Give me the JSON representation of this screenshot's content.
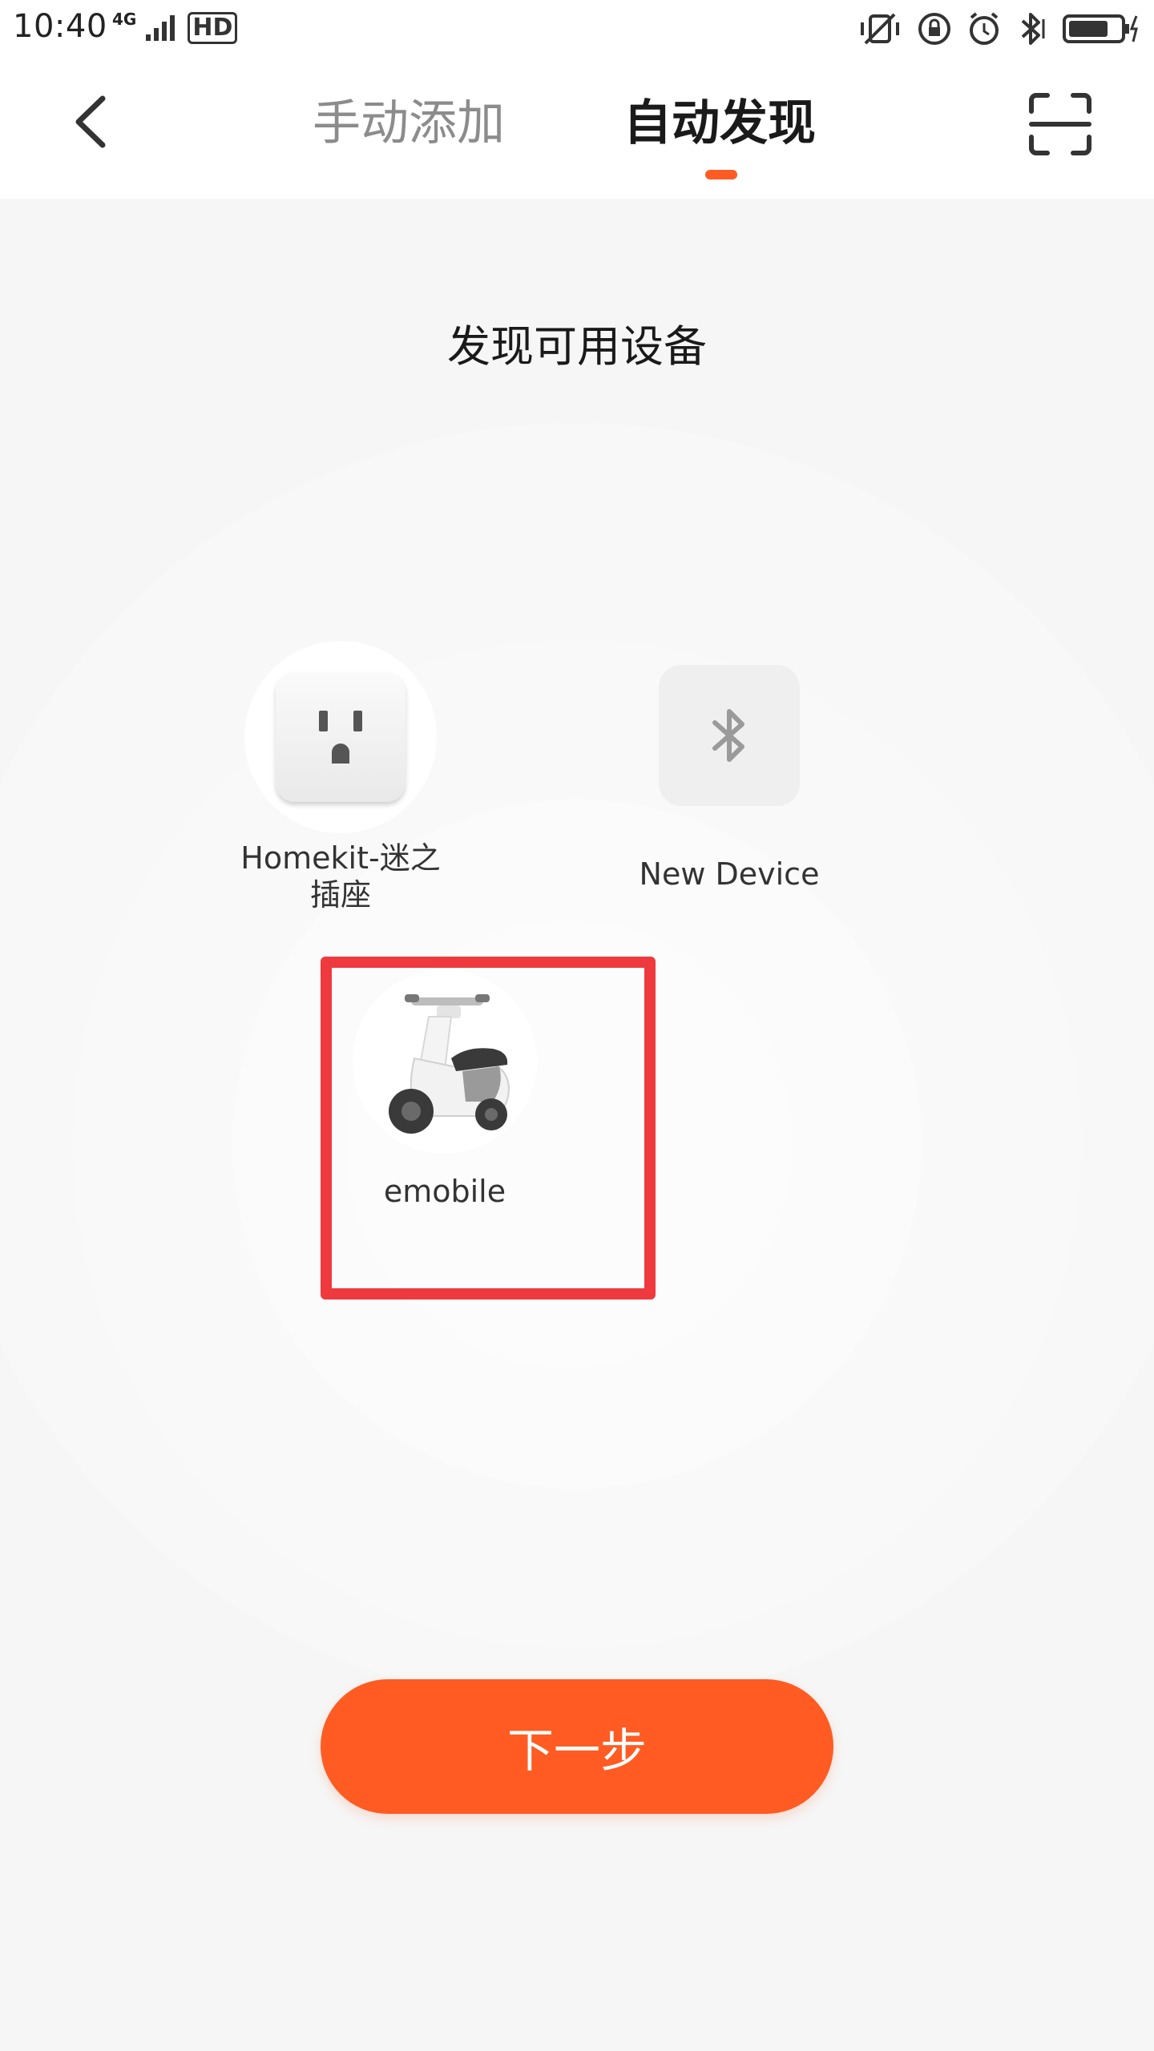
{
  "status_bar": {
    "time": "10:40",
    "network": "4G",
    "hd": "HD"
  },
  "header": {
    "tabs": [
      {
        "label": "手动添加",
        "active": false
      },
      {
        "label": "自动发现",
        "active": true
      }
    ]
  },
  "main": {
    "heading": "发现可用设备",
    "devices": [
      {
        "name": "Homekit-迷之插座",
        "icon": "power-socket-icon"
      },
      {
        "name": "New Device",
        "icon": "bluetooth-icon"
      },
      {
        "name": "emobile",
        "icon": "scooter-icon"
      }
    ],
    "next_button": "下一步"
  },
  "colors": {
    "accent": "#ff5b22",
    "highlight_border": "#ee3a3e",
    "background": "#f6f6f6"
  }
}
